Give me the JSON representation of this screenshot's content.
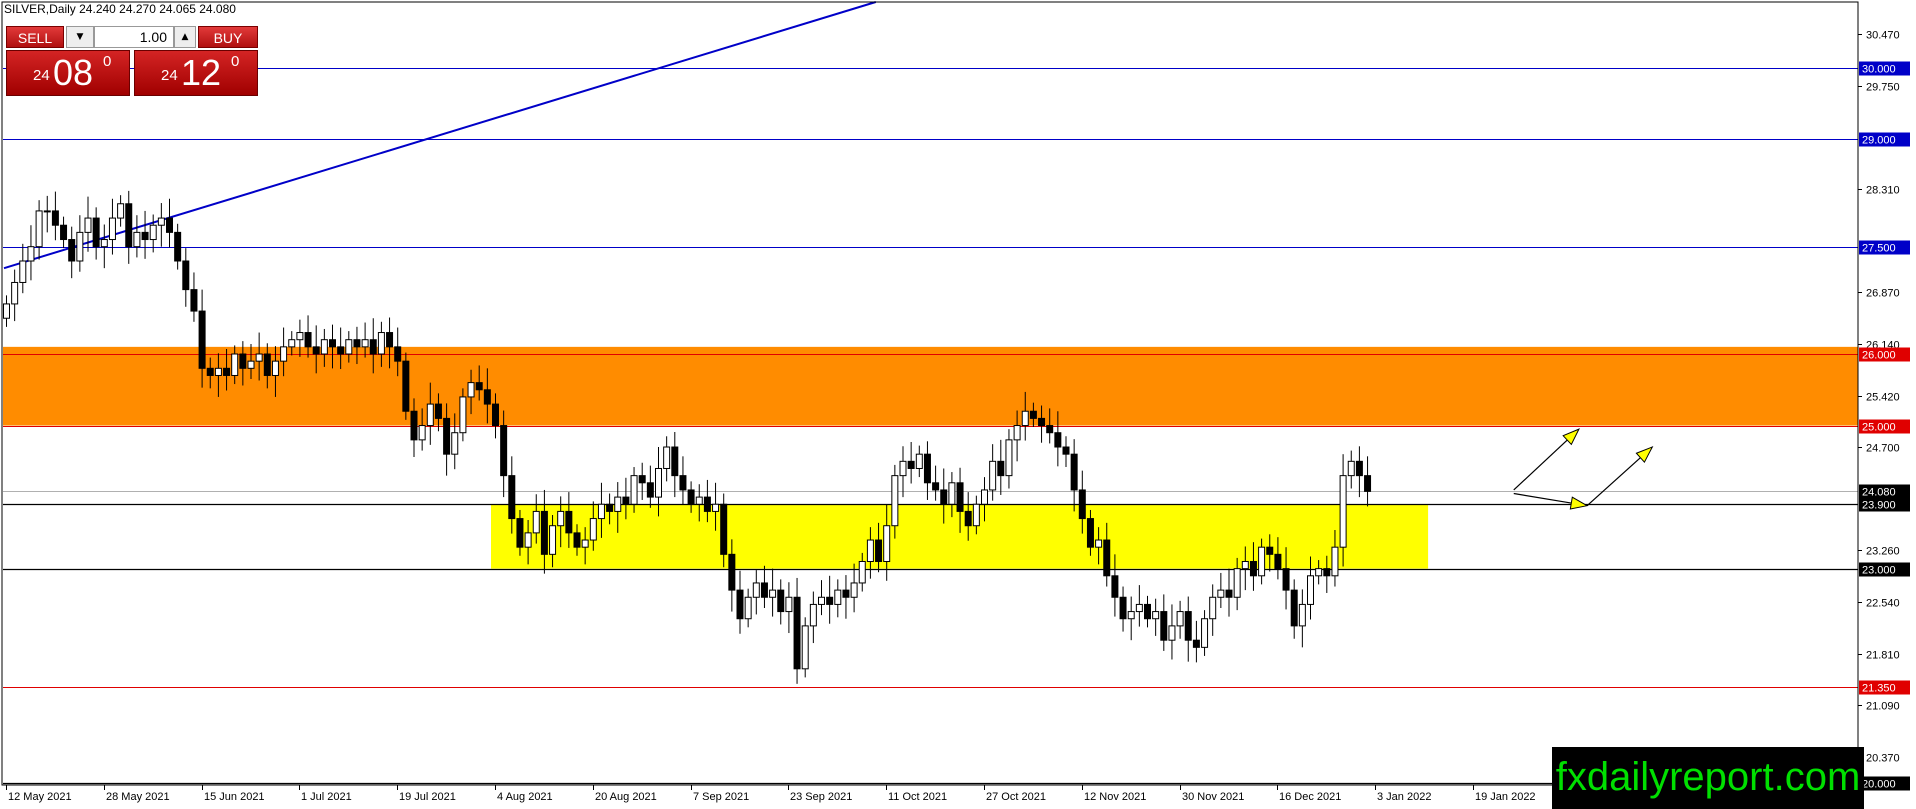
{
  "header": {
    "text": "SILVER,Daily  24.240 24.270 24.065 24.080"
  },
  "trade_panel": {
    "sell_label": "SELL",
    "buy_label": "BUY",
    "lot_value": "1.00",
    "sell_price_big": "24",
    "sell_price_main": "08",
    "sell_price_sup": "0",
    "buy_price_big": "24",
    "buy_price_main": "12",
    "buy_price_sup": "0"
  },
  "watermark": "fxdailyreport.com",
  "colors": {
    "candle_bull": "#ffffff",
    "candle_bear": "#000000",
    "orange_zone": "#ff8c00",
    "yellow_zone": "#ffff00",
    "blue_line": "#0000c8",
    "red_line": "#e00000",
    "arrow_fill": "#ffff00"
  },
  "chart_data": {
    "type": "candlestick",
    "title": "SILVER,Daily",
    "ohlc_readout": {
      "open": 24.24,
      "high": 24.27,
      "low": 24.065,
      "close": 24.08
    },
    "ylim": [
      19.99,
      30.92
    ],
    "y_ticks": [
      "30.470",
      "29.750",
      "28.310",
      "26.870",
      "26.140",
      "25.420",
      "24.700",
      "23.260",
      "22.540",
      "21.810",
      "21.090",
      "20.370"
    ],
    "x_ticks": [
      {
        "label": "12 May 2021",
        "index": 0
      },
      {
        "label": "28 May 2021",
        "index": 12
      },
      {
        "label": "15 Jun 2021",
        "index": 24
      },
      {
        "label": "1 Jul 2021",
        "index": 36
      },
      {
        "label": "19 Jul 2021",
        "index": 48
      },
      {
        "label": "4 Aug 2021",
        "index": 60
      },
      {
        "label": "20 Aug 2021",
        "index": 72
      },
      {
        "label": "7 Sep 2021",
        "index": 84
      },
      {
        "label": "23 Sep 2021",
        "index": 96
      },
      {
        "label": "11 Oct 2021",
        "index": 108
      },
      {
        "label": "27 Oct 2021",
        "index": 120
      },
      {
        "label": "12 Nov 2021",
        "index": 132
      },
      {
        "label": "30 Nov 2021",
        "index": 144
      },
      {
        "label": "16 Dec 2021",
        "index": 156
      },
      {
        "label": "3 Jan 2022",
        "index": 168
      },
      {
        "label": "19 Jan 2022",
        "index": 180
      }
    ],
    "levels": [
      {
        "label": "30.000",
        "value": 30.0,
        "color": "#0000c8"
      },
      {
        "label": "29.000",
        "value": 29.0,
        "color": "#0000c8"
      },
      {
        "label": "27.500",
        "value": 27.5,
        "color": "#0000c8"
      },
      {
        "label": "26.000",
        "value": 26.0,
        "color": "#e00000"
      },
      {
        "label": "25.000",
        "value": 25.0,
        "color": "#e00000"
      },
      {
        "label": "24.080",
        "value": 24.08,
        "color": "#000000"
      },
      {
        "label": "23.900",
        "value": 23.9,
        "color": "#000000"
      },
      {
        "label": "23.000",
        "value": 23.0,
        "color": "#000000"
      },
      {
        "label": "21.350",
        "value": 21.35,
        "color": "#e00000"
      },
      {
        "label": "20.000",
        "value": 20.0,
        "color": "#000000"
      }
    ],
    "zones": [
      {
        "name": "resistance",
        "from": 25.0,
        "to": 26.1,
        "color": "#ff8c00"
      },
      {
        "name": "support",
        "from": 23.0,
        "to": 23.9,
        "color": "#ffff00"
      }
    ],
    "trendline": {
      "start": {
        "index": 0,
        "value": 27.2
      },
      "end": {
        "index": 105,
        "value": 30.92
      },
      "color": "#0000c8"
    },
    "arrows": [
      {
        "from": {
          "index": 185,
          "value": 24.1
        },
        "to": {
          "index": 193,
          "value": 24.95
        }
      },
      {
        "from": {
          "index": 185,
          "value": 24.05
        },
        "to": {
          "index": 194,
          "value": 23.88
        }
      },
      {
        "from": {
          "index": 194,
          "value": 23.88
        },
        "to": {
          "index": 202,
          "value": 24.7
        }
      }
    ],
    "closes": [
      26.7,
      27.0,
      27.3,
      27.5,
      28.0,
      28.0,
      27.8,
      27.6,
      27.3,
      27.7,
      27.9,
      27.5,
      27.6,
      27.9,
      28.1,
      27.5,
      27.7,
      27.6,
      27.8,
      27.9,
      27.7,
      27.3,
      26.9,
      26.6,
      25.8,
      25.7,
      25.8,
      25.7,
      26.0,
      25.8,
      25.9,
      26.0,
      25.7,
      25.9,
      26.1,
      26.2,
      26.3,
      26.1,
      26.0,
      26.2,
      26.1,
      26.0,
      26.2,
      26.1,
      26.2,
      26.0,
      26.3,
      26.1,
      25.9,
      25.2,
      24.8,
      25.0,
      25.3,
      25.1,
      24.6,
      24.9,
      25.4,
      25.6,
      25.5,
      25.3,
      25.0,
      24.3,
      23.7,
      23.3,
      23.5,
      23.8,
      23.2,
      23.6,
      23.8,
      23.5,
      23.3,
      23.4,
      23.7,
      23.9,
      23.8,
      24.0,
      23.9,
      24.3,
      24.2,
      24.0,
      24.4,
      24.7,
      24.3,
      24.1,
      23.9,
      24.0,
      23.8,
      23.9,
      23.2,
      22.7,
      22.3,
      22.6,
      22.8,
      22.6,
      22.7,
      22.4,
      22.6,
      21.6,
      22.2,
      22.5,
      22.6,
      22.5,
      22.7,
      22.6,
      22.8,
      23.1,
      23.4,
      23.1,
      23.6,
      24.3,
      24.5,
      24.4,
      24.6,
      24.2,
      24.1,
      23.9,
      24.2,
      23.8,
      23.6,
      23.9,
      24.1,
      24.5,
      24.3,
      24.8,
      25.0,
      25.2,
      25.1,
      25.0,
      24.9,
      24.7,
      24.6,
      24.1,
      23.7,
      23.3,
      23.4,
      22.9,
      22.6,
      22.3,
      22.4,
      22.5,
      22.3,
      22.4,
      22.0,
      22.2,
      22.4,
      22.0,
      21.9,
      22.3,
      22.6,
      22.7,
      22.6,
      23.0,
      23.1,
      22.9,
      23.3,
      23.2,
      23.0,
      22.7,
      22.2,
      22.5,
      22.9,
      23.0,
      22.9,
      23.3,
      24.3,
      24.5,
      24.3,
      24.08
    ]
  }
}
